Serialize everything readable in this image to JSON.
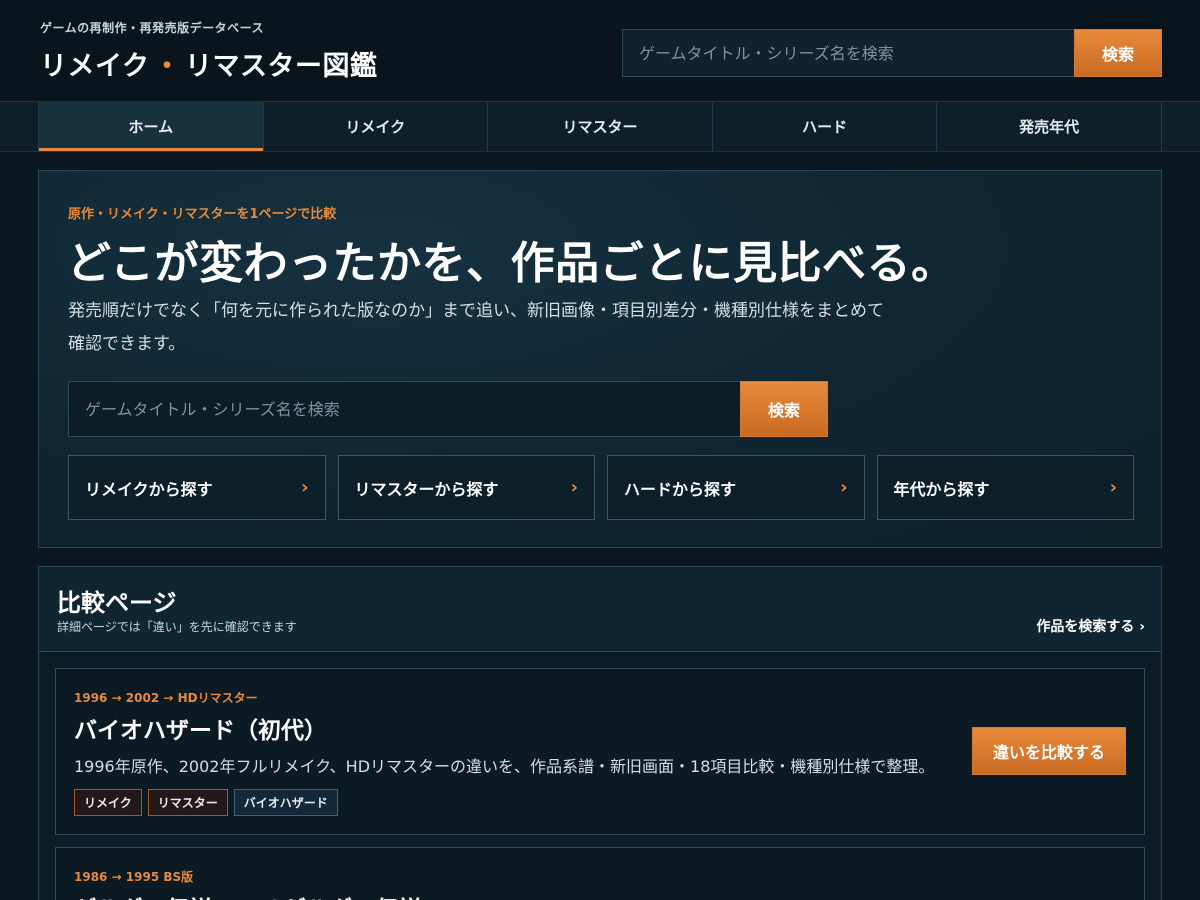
{
  "header": {
    "tagline": "ゲームの再制作・再発売版データベース",
    "title_part1": "リメイク",
    "title_dot": "・",
    "title_part2": "リマスター図鑑",
    "search_placeholder": "ゲームタイトル・シリーズ名を検索",
    "search_button": "検索"
  },
  "nav": {
    "tabs": [
      {
        "label": "ホーム",
        "active": true
      },
      {
        "label": "リメイク"
      },
      {
        "label": "リマスター"
      },
      {
        "label": "ハード"
      },
      {
        "label": "発売年代"
      }
    ]
  },
  "hero": {
    "eyebrow": "原作・リメイク・リマスターを1ページで比較",
    "title": "どこが変わったかを、作品ごとに見比べる。",
    "description": "発売順だけでなく「何を元に作られた版なのか」まで追い、新旧画像・項目別差分・機種別仕様をまとめて確認できます。",
    "search_placeholder": "ゲームタイトル・シリーズ名を検索",
    "search_button": "検索",
    "quick_links": [
      {
        "label": "リメイクから探す",
        "chevron": "›"
      },
      {
        "label": "リマスターから探す",
        "chevron": "›"
      },
      {
        "label": "ハードから探す",
        "chevron": "›"
      },
      {
        "label": "年代から探す",
        "chevron": "›"
      }
    ]
  },
  "compare": {
    "title": "比較ページ",
    "subtitle": "詳細ページでは「違い」を先に確認できます",
    "link": "作品を検索する ›",
    "cards": [
      {
        "eyebrow": "1996 → 2002 → HDリマスター",
        "title": "バイオハザード（初代）",
        "description": "1996年原作、2002年フルリメイク、HDリマスターの違いを、作品系譜・新旧画面・18項目比較・機種別仕様で整理。",
        "tags": [
          "リメイク",
          "リマスター",
          "バイオハザード"
        ],
        "cta": "違いを比較する"
      },
      {
        "eyebrow": "1986 → 1995 BS版",
        "title": "ゼルダの伝説 → BSゼルダの伝説"
      }
    ]
  },
  "colors": {
    "accent": "#e8893a",
    "background": "#0b1822",
    "panel": "#0f2530"
  }
}
